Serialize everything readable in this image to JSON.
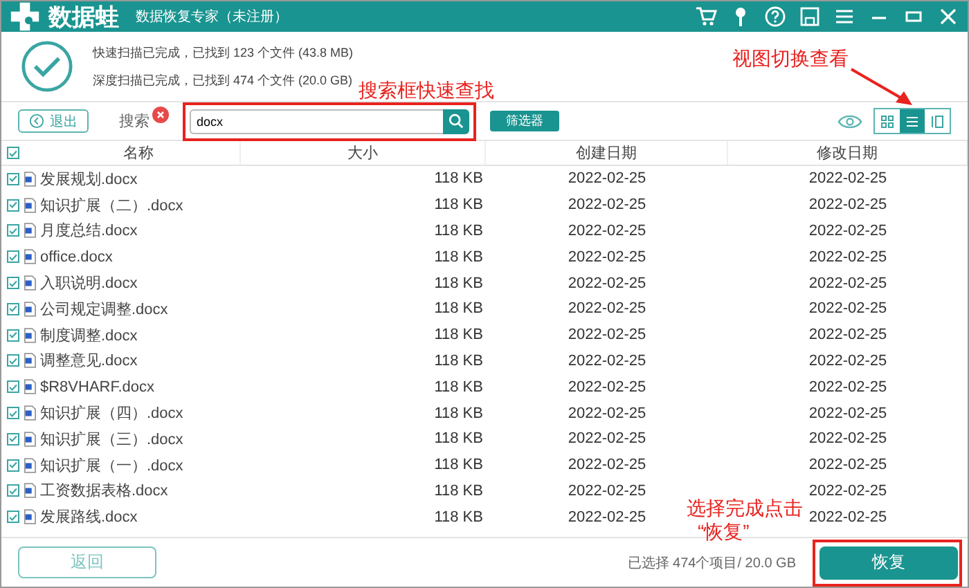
{
  "window": {
    "logo": "数据蛙",
    "title": "数据恢复专家（未注册）"
  },
  "summary": {
    "lines": [
      "快速扫描已完成，已找到 123 个文件 (43.8 MB)",
      "深度扫描已完成，已找到 474 个文件 (20.0 GB)"
    ]
  },
  "toolbar": {
    "exit": "退出",
    "search_label": "搜索",
    "search": {
      "value": "docx"
    },
    "filter": "筛选器",
    "view_modes": [
      {
        "kind": "grid",
        "selected": false
      },
      {
        "kind": "list",
        "selected": true
      },
      {
        "kind": "detail",
        "selected": false
      }
    ]
  },
  "table": {
    "all_checked": true,
    "columns": [
      "名称",
      "大小",
      "创建日期",
      "修改日期"
    ],
    "rows": [
      {
        "name": "发展规划.docx",
        "size": "118 KB",
        "created": "2022-02-25",
        "modified": "2022-02-25",
        "checked": true
      },
      {
        "name": "知识扩展（二）.docx",
        "size": "118 KB",
        "created": "2022-02-25",
        "modified": "2022-02-25",
        "checked": true
      },
      {
        "name": "月度总结.docx",
        "size": "118 KB",
        "created": "2022-02-25",
        "modified": "2022-02-25",
        "checked": true
      },
      {
        "name": "office.docx",
        "size": "118 KB",
        "created": "2022-02-25",
        "modified": "2022-02-25",
        "checked": true
      },
      {
        "name": "入职说明.docx",
        "size": "118 KB",
        "created": "2022-02-25",
        "modified": "2022-02-25",
        "checked": true
      },
      {
        "name": "公司规定调整.docx",
        "size": "118 KB",
        "created": "2022-02-25",
        "modified": "2022-02-25",
        "checked": true
      },
      {
        "name": "制度调整.docx",
        "size": "118 KB",
        "created": "2022-02-25",
        "modified": "2022-02-25",
        "checked": true
      },
      {
        "name": "调整意见.docx",
        "size": "118 KB",
        "created": "2022-02-25",
        "modified": "2022-02-25",
        "checked": true
      },
      {
        "name": "$R8VHARF.docx",
        "size": "118 KB",
        "created": "2022-02-25",
        "modified": "2022-02-25",
        "checked": true
      },
      {
        "name": "知识扩展（四）.docx",
        "size": "118 KB",
        "created": "2022-02-25",
        "modified": "2022-02-25",
        "checked": true
      },
      {
        "name": "知识扩展（三）.docx",
        "size": "118 KB",
        "created": "2022-02-25",
        "modified": "2022-02-25",
        "checked": true
      },
      {
        "name": "知识扩展（一）.docx",
        "size": "118 KB",
        "created": "2022-02-25",
        "modified": "2022-02-25",
        "checked": true
      },
      {
        "name": "工资数据表格.docx",
        "size": "118 KB",
        "created": "2022-02-25",
        "modified": "2022-02-25",
        "checked": true
      },
      {
        "name": "发展路线.docx",
        "size": "118 KB",
        "created": "2022-02-25",
        "modified": "2022-02-25",
        "checked": true
      }
    ]
  },
  "footer": {
    "back": "返回",
    "selected_info": "已选择 474个项目/ 20.0 GB",
    "recover": "恢复"
  },
  "annotations": [
    "搜索框快速查找",
    "视图切换查看",
    "选择完成点击",
    "“恢复”"
  ]
}
